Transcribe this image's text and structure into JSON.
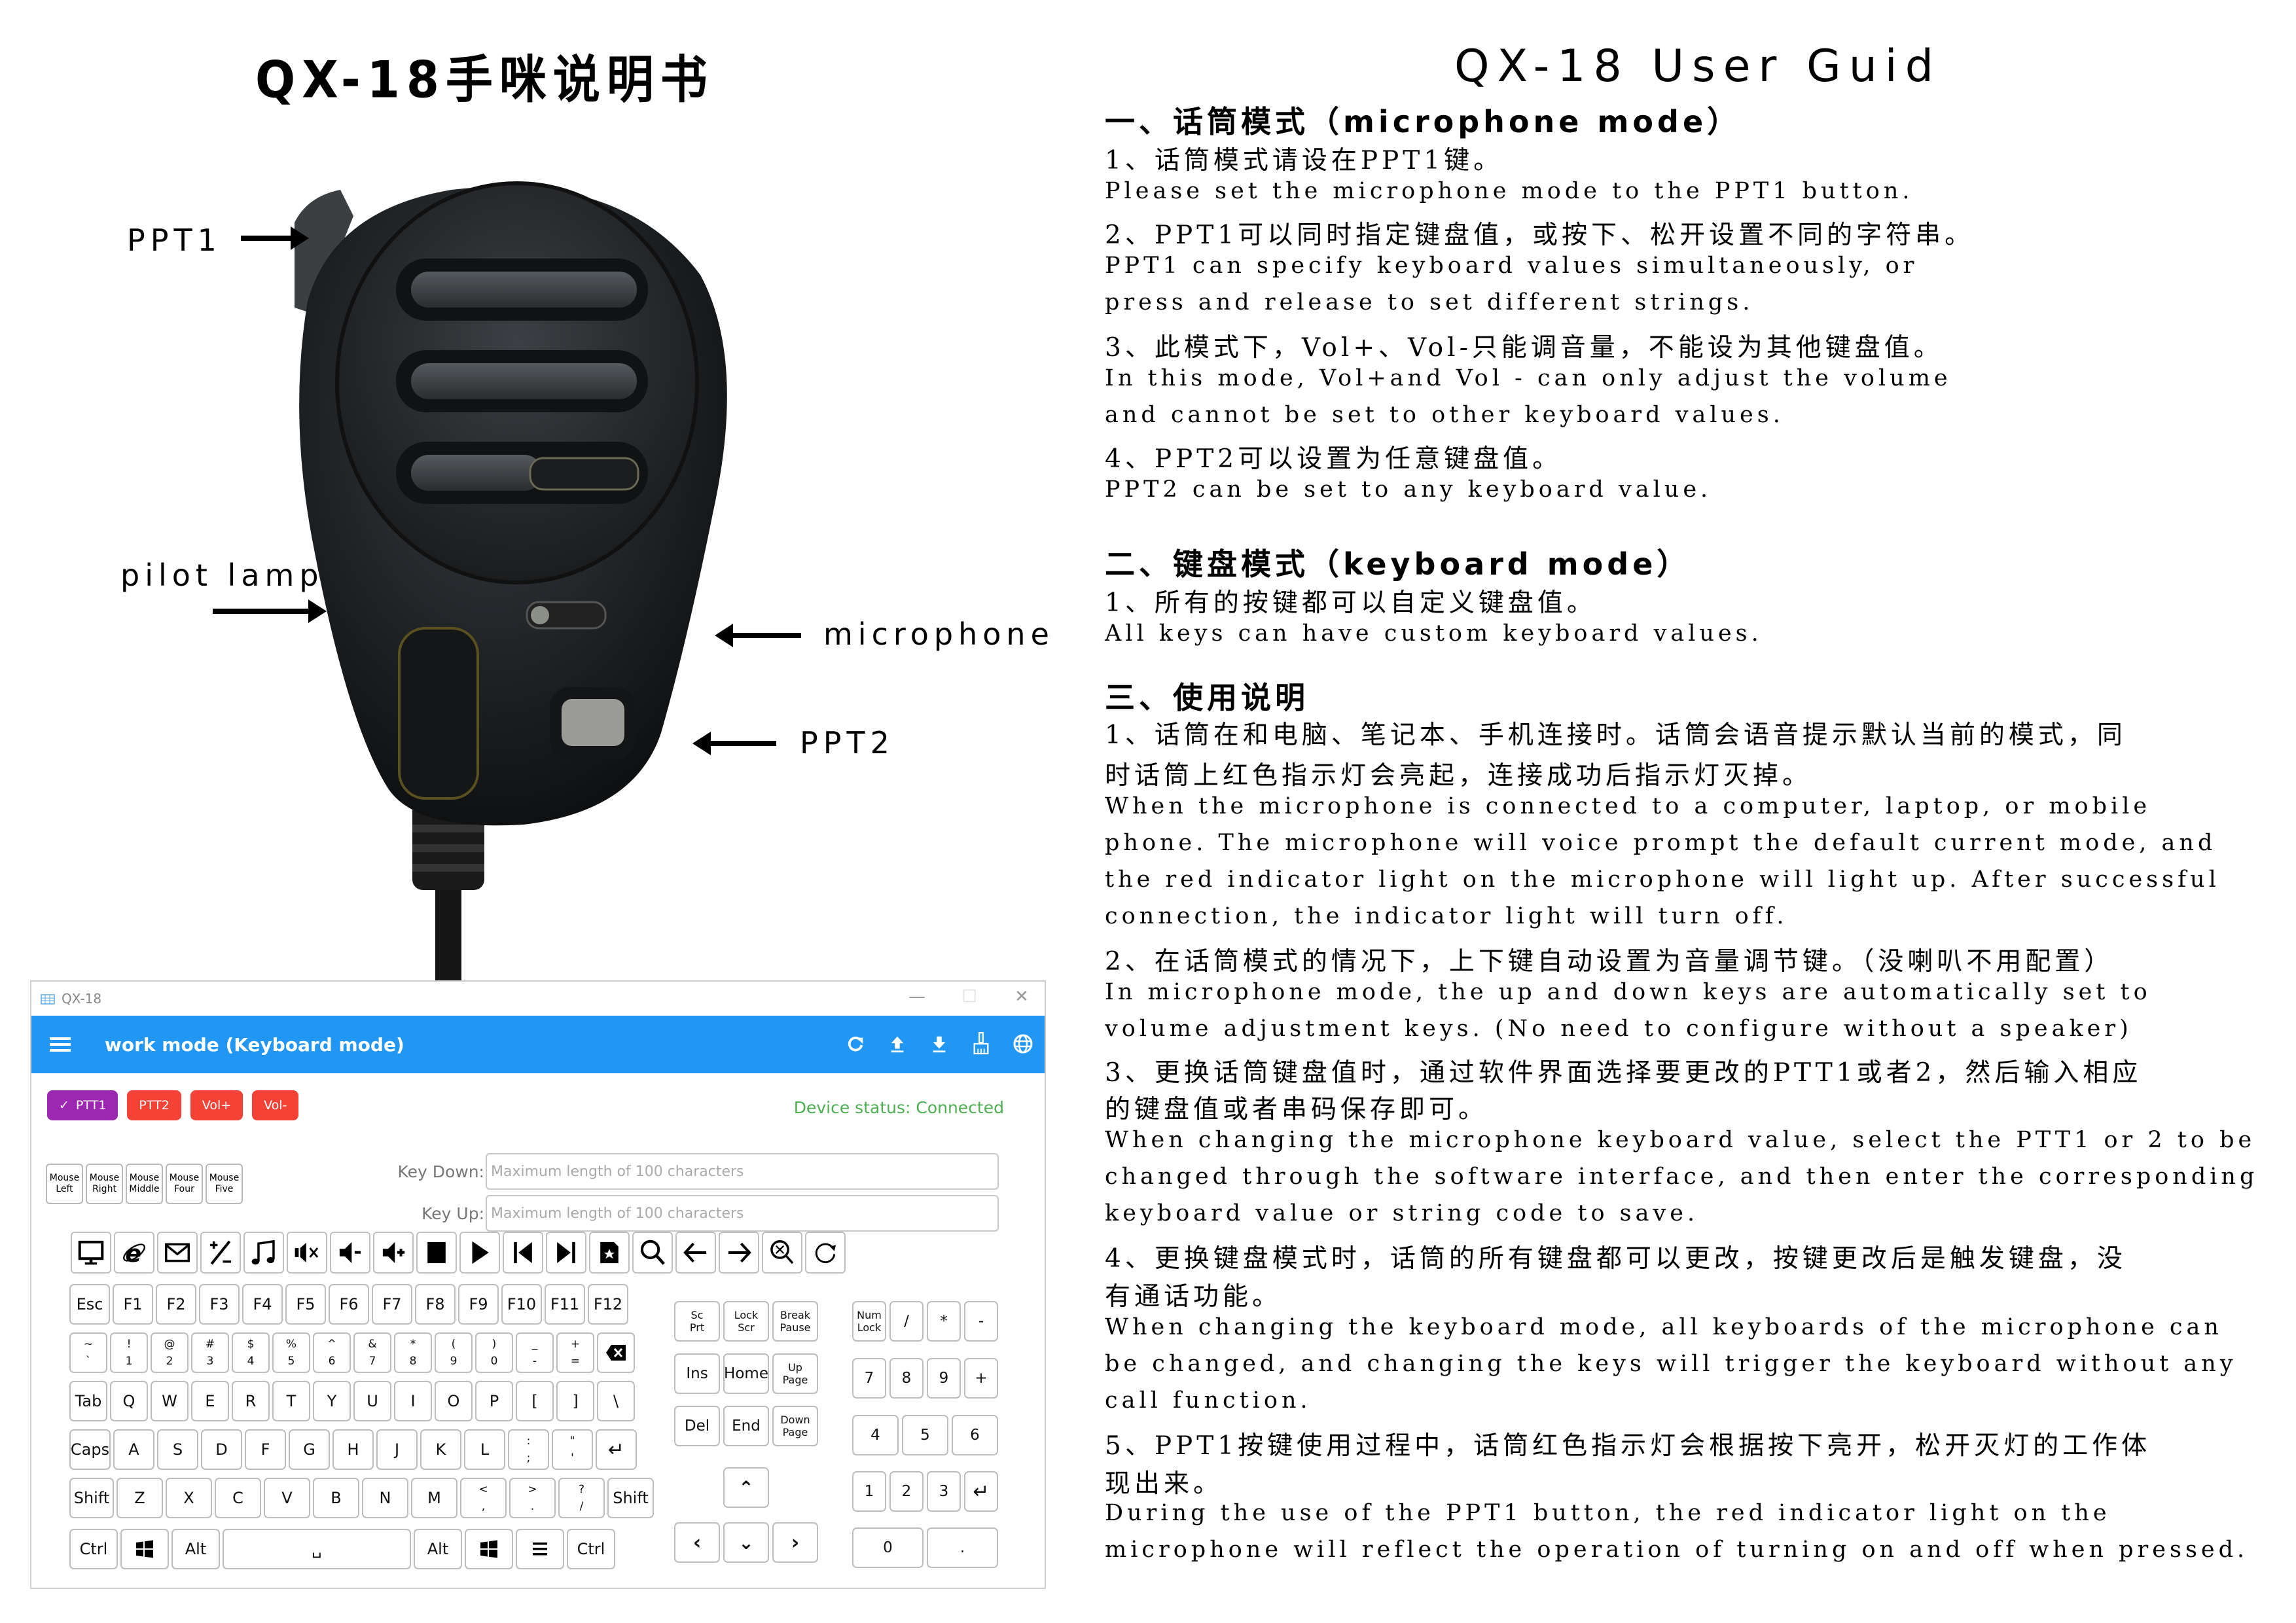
{
  "left_title": "QX-18手咪说明书",
  "right_title": "QX-18 User Guid",
  "illustration": {
    "callouts": [
      {
        "id": "ppt1",
        "label": "PPT1",
        "arrow": "right"
      },
      {
        "id": "pilot-lamp",
        "label": "pilot lamp",
        "arrow": "right"
      },
      {
        "id": "microphone",
        "label": "microphone",
        "arrow": "left"
      },
      {
        "id": "ppt2",
        "label": "PPT2",
        "arrow": "left"
      }
    ]
  },
  "app": {
    "window_title": "QX-18",
    "window_controls": {
      "minimize": "—",
      "maximize": "☐",
      "close": "✕"
    },
    "header_title": "work mode (Keyboard mode)",
    "header_actions": [
      "refresh-icon",
      "upload-icon",
      "download-icon",
      "broom-icon",
      "globe-icon"
    ],
    "chips": [
      {
        "label": "PTT1",
        "active": true,
        "check": "✓"
      },
      {
        "label": "PTT2",
        "active": false
      },
      {
        "label": "Vol+",
        "active": false
      },
      {
        "label": "Vol-",
        "active": false
      }
    ],
    "device_status": "Device status: Connected",
    "colors": {
      "accent": "#2196F3",
      "chip_active": "#9C27B0",
      "chip_inactive": "#F44336",
      "status": "#4CAF50"
    },
    "mouse_keys": [
      {
        "l1": "Mouse",
        "l2": "Left"
      },
      {
        "l1": "Mouse",
        "l2": "Right"
      },
      {
        "l1": "Mouse",
        "l2": "Middle"
      },
      {
        "l1": "Mouse",
        "l2": "Four"
      },
      {
        "l1": "Mouse",
        "l2": "Five"
      }
    ],
    "key_down": {
      "label": "Key Down:",
      "value": "",
      "placeholder": "Maximum length of 100 characters"
    },
    "key_up": {
      "label": "Key Up:",
      "value": "",
      "placeholder": "Maximum length of 100 characters"
    },
    "media_keys": [
      "computer-icon",
      "browser-icon",
      "mail-icon",
      "calculator-icon",
      "music-icon",
      "mute-icon",
      "volume-down-icon",
      "volume-up-icon",
      "stop-icon",
      "play-icon",
      "previous-track-icon",
      "next-track-icon",
      "favorites-icon",
      "search-icon",
      "back-arrow-icon",
      "forward-arrow-icon",
      "search-stop-icon",
      "refresh-icon"
    ],
    "keyboard": {
      "row_f": [
        "Esc",
        "F1",
        "F2",
        "F3",
        "F4",
        "F5",
        "F6",
        "F7",
        "F8",
        "F9",
        "F10",
        "F11",
        "F12"
      ],
      "row_num": [
        {
          "top": "~",
          "bottom": "`"
        },
        {
          "top": "!",
          "bottom": "1"
        },
        {
          "top": "@",
          "bottom": "2"
        },
        {
          "top": "#",
          "bottom": "3"
        },
        {
          "top": "$",
          "bottom": "4"
        },
        {
          "top": "%",
          "bottom": "5"
        },
        {
          "top": "^",
          "bottom": "6"
        },
        {
          "top": "&",
          "bottom": "7"
        },
        {
          "top": "*",
          "bottom": "8"
        },
        {
          "top": "(",
          "bottom": "9"
        },
        {
          "top": ")",
          "bottom": "0"
        },
        {
          "top": "_",
          "bottom": "-"
        },
        {
          "top": "+",
          "bottom": "="
        }
      ],
      "backspace": "⌫",
      "row_q": [
        "Tab",
        "Q",
        "W",
        "E",
        "R",
        "T",
        "Y",
        "U",
        "I",
        "O",
        "P",
        "[",
        "]",
        "\\"
      ],
      "row_a": [
        "Caps",
        "A",
        "S",
        "D",
        "F",
        "G",
        "H",
        "J",
        "K",
        "L"
      ],
      "row_a_dual": [
        {
          "top": ":",
          "bottom": ";"
        },
        {
          "top": "\"",
          "bottom": "'"
        }
      ],
      "enter": "↵",
      "row_z_left": "Shift",
      "row_z": [
        "Z",
        "X",
        "C",
        "V",
        "B",
        "N",
        "M"
      ],
      "row_z_dual": [
        {
          "top": "<",
          "bottom": ","
        },
        {
          "top": ">",
          "bottom": "."
        },
        {
          "top": "?",
          "bottom": "/"
        }
      ],
      "row_z_right": "Shift",
      "bottom": {
        "ctrl_l": "Ctrl",
        "alt_l": "Alt",
        "space": "␣",
        "alt_r": "Alt",
        "ctrl_r": "Ctrl"
      }
    },
    "nav_cluster": {
      "row1": [
        {
          "l1": "Sc",
          "l2": "Prt"
        },
        {
          "l1": "Lock",
          "l2": "Scr"
        },
        {
          "l1": "Break",
          "l2": "Pause"
        }
      ],
      "row2": [
        {
          "l1": "Ins"
        },
        {
          "l1": "Home"
        },
        {
          "l1": "Up",
          "l2": "Page"
        }
      ],
      "row3": [
        {
          "l1": "Del"
        },
        {
          "l1": "End"
        },
        {
          "l1": "Down",
          "l2": "Page"
        }
      ],
      "up": "⌃",
      "left": "‹",
      "down": "⌄",
      "right": "›"
    },
    "numpad": {
      "numlock": {
        "l1": "Num",
        "l2": "Lock"
      },
      "divide": "/",
      "multiply": "*",
      "minus": "-",
      "n7": "7",
      "n8": "8",
      "n9": "9",
      "plus": "+",
      "n4": "4",
      "n5": "5",
      "n6": "6",
      "n1": "1",
      "n2": "2",
      "n3": "3",
      "enter": "↵",
      "n0": "0",
      "dot": "."
    }
  },
  "document": {
    "lines": [
      {
        "type": "heading",
        "text": "一、话筒模式（microphone mode）"
      },
      {
        "type": "cn",
        "text": "1、话筒模式请设在PPT1键。"
      },
      {
        "type": "en",
        "text": "Please set the microphone mode to the PPT1 button."
      },
      {
        "type": "cn",
        "text": "2、PPT1可以同时指定键盘值，或按下、松开设置不同的字符串。"
      },
      {
        "type": "en",
        "text": "PPT1 can specify keyboard values simultaneously, or"
      },
      {
        "type": "en",
        "text": "press and release to set different strings."
      },
      {
        "type": "cn",
        "text": "3、此模式下，Vol+、Vol-只能调音量，不能设为其他键盘值。"
      },
      {
        "type": "en",
        "text": "In this mode, Vol+and Vol - can only adjust the volume"
      },
      {
        "type": "en",
        "text": "and cannot be set to other keyboard values."
      },
      {
        "type": "cn",
        "text": "4、PPT2可以设置为任意键盘值。"
      },
      {
        "type": "en",
        "text": "PPT2 can be set to any keyboard value."
      },
      {
        "type": "heading",
        "text": "二、键盘模式（keyboard mode）"
      },
      {
        "type": "cn",
        "text": "1、所有的按键都可以自定义键盘值。"
      },
      {
        "type": "en",
        "text": "All keys can have custom keyboard values."
      },
      {
        "type": "heading",
        "text": "三、使用说明"
      },
      {
        "type": "cn",
        "text": "1、话筒在和电脑、笔记本、手机连接时。话筒会语音提示默认当前的模式，同"
      },
      {
        "type": "cn",
        "text": "时话筒上红色指示灯会亮起，连接成功后指示灯灭掉。"
      },
      {
        "type": "en",
        "text": "  When the microphone is connected to a computer, laptop, or mobile"
      },
      {
        "type": "en",
        "text": "phone. The microphone will voice prompt the default current mode, and"
      },
      {
        "type": "en",
        "text": "the red indicator light on the microphone will light up. After successful"
      },
      {
        "type": "en",
        "text": "connection, the indicator light will turn off."
      },
      {
        "type": "cn",
        "text": "2、在话筒模式的情况下，上下键自动设置为音量调节键。（没喇叭不用配置）"
      },
      {
        "type": "en",
        "text": "In microphone mode, the up and down keys are automatically set to"
      },
      {
        "type": "en",
        "text": "volume adjustment keys. (No need to configure without a speaker)"
      },
      {
        "type": "cn",
        "text": "3、更换话筒键盘值时，通过软件界面选择要更改的PTT1或者2，然后输入相应"
      },
      {
        "type": "cn",
        "text": "的键盘值或者串码保存即可。"
      },
      {
        "type": "en",
        "text": "When changing the microphone keyboard value, select the PTT1 or 2 to be"
      },
      {
        "type": "en",
        "text": "changed through the software interface, and then enter the corresponding"
      },
      {
        "type": "en",
        "text": "keyboard value or string code to save."
      },
      {
        "type": "cn",
        "text": "4、更换键盘模式时，话筒的所有键盘都可以更改，按键更改后是触发键盘，没"
      },
      {
        "type": "cn",
        "text": "有通话功能。"
      },
      {
        "type": "en",
        "text": "When changing the keyboard mode, all keyboards of the microphone can"
      },
      {
        "type": "en",
        "text": "be changed, and changing the keys will trigger the keyboard without any"
      },
      {
        "type": "en",
        "text": "call function."
      },
      {
        "type": "cn",
        "text": "5、PPT1按键使用过程中，话筒红色指示灯会根据按下亮开，松开灭灯的工作体"
      },
      {
        "type": "cn",
        "text": "现出来。"
      },
      {
        "type": "en",
        "text": "During the use of the PPT1 button, the red indicator light on the"
      },
      {
        "type": "en",
        "text": "microphone will reflect the operation of turning on and off when pressed."
      }
    ]
  }
}
